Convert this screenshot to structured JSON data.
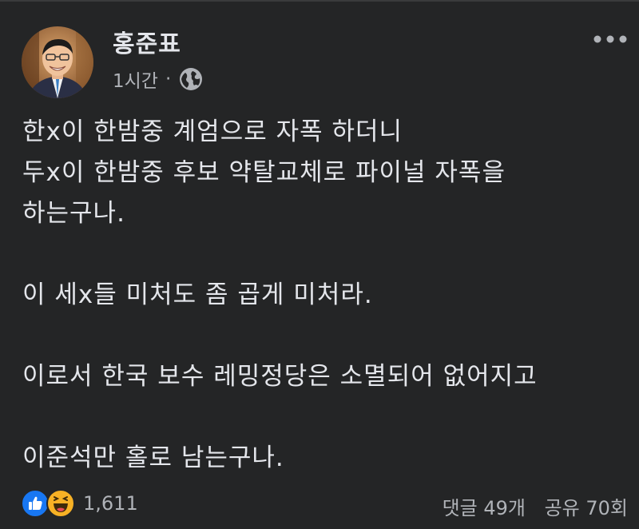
{
  "post": {
    "author": "홍준표",
    "time": "1시간",
    "separator": "·",
    "privacy_icon": "globe-icon",
    "more_icon": "more-horizontal-icon",
    "lines": [
      "한x이 한밤중 계엄으로 자폭 하더니",
      "두x이 한밤중 후보 약탈교체로 파이널 자폭을",
      "하는구나.",
      "",
      "이 세x들 미처도 좀 곱게 미처라.",
      "",
      "이로서 한국 보수 레밍정당은 소멸되어 없어지고",
      "",
      "이준석만 홀로 남는구나."
    ]
  },
  "footer": {
    "reaction_icons": [
      "like-icon",
      "haha-icon"
    ],
    "reaction_count": "1,611",
    "comments": "댓글 49개",
    "shares": "공유 70회"
  },
  "colors": {
    "background": "#242526",
    "primary_text": "#e4e6eb",
    "secondary_text": "#b0b3b8",
    "like_blue": "#1877f2",
    "haha_yellow": "#f7b125"
  }
}
